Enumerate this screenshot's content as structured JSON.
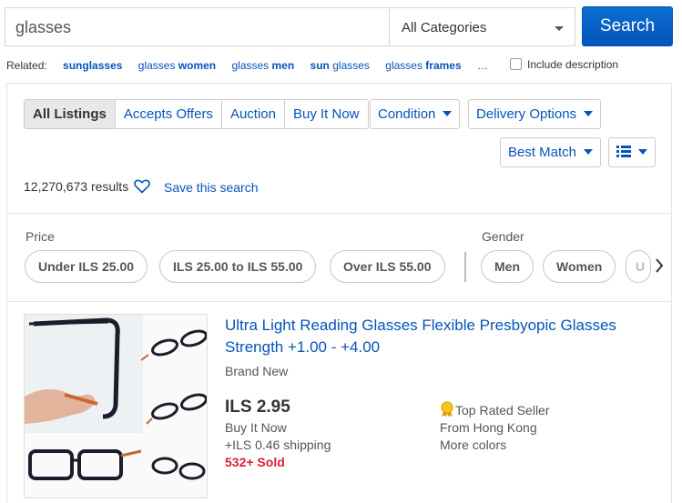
{
  "search": {
    "query": "glasses",
    "category": "All Categories",
    "button": "Search"
  },
  "related": {
    "label": "Related:",
    "items": [
      {
        "pre": "",
        "bold": "sunglasses",
        "post": ""
      },
      {
        "pre": "glasses ",
        "bold": "women",
        "post": ""
      },
      {
        "pre": "glasses ",
        "bold": "men",
        "post": ""
      },
      {
        "pre": "",
        "bold": "sun",
        "post": " glasses"
      },
      {
        "pre": "glasses ",
        "bold": "frames",
        "post": ""
      }
    ],
    "more": "…",
    "include_description": "Include description"
  },
  "tabs": [
    "All Listings",
    "Accepts Offers",
    "Auction",
    "Buy It Now"
  ],
  "dropdowns": {
    "condition": "Condition",
    "delivery": "Delivery Options",
    "sort": "Best Match"
  },
  "results": {
    "count": "12,270,673 results",
    "save": "Save this search"
  },
  "facets": {
    "price_label": "Price",
    "price_options": [
      "Under ILS 25.00",
      "ILS 25.00 to ILS 55.00",
      "Over ILS 55.00"
    ],
    "gender_label": "Gender",
    "gender_options": [
      "Men",
      "Women",
      "U"
    ]
  },
  "listing": {
    "title": "Ultra Light Reading Glasses Flexible Presbyopic Glasses Strength +1.00 - +4.00",
    "condition": "Brand New",
    "price": "ILS 2.95",
    "format": "Buy It Now",
    "shipping": "+ILS 0.46 shipping",
    "sold": "532+ Sold",
    "seller_badge": "Top Rated Seller",
    "location": "From Hong Kong",
    "more_colors": "More colors"
  },
  "colors": {
    "link": "#0654ba",
    "sold": "#dd1e31",
    "button": "#0654ba"
  }
}
